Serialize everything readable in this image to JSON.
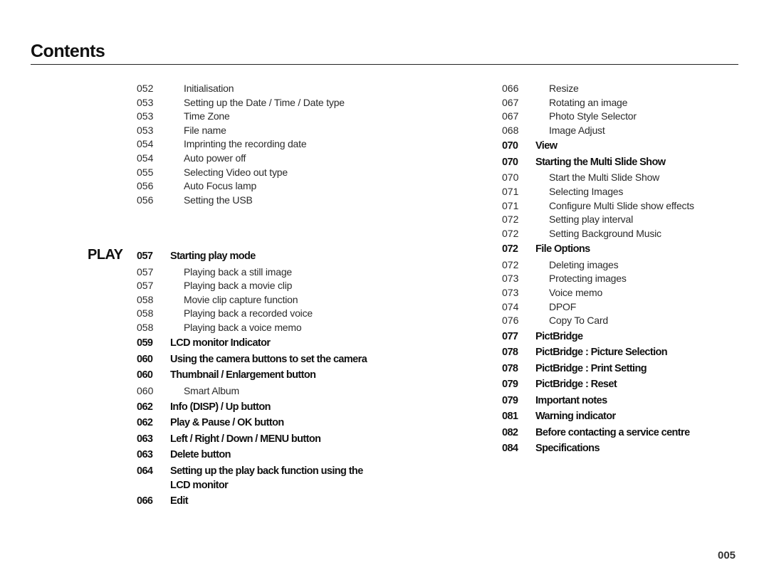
{
  "page": {
    "title": "Contents",
    "section_label": "PLAY",
    "page_number": "005"
  },
  "left_column": {
    "pre_section_entries": [
      {
        "page": "052",
        "text": "Initialisation",
        "level": "sub"
      },
      {
        "page": "053",
        "text": "Setting up the Date / Time / Date type",
        "level": "sub"
      },
      {
        "page": "053",
        "text": "Time Zone",
        "level": "sub"
      },
      {
        "page": "053",
        "text": "File name",
        "level": "sub"
      },
      {
        "page": "054",
        "text": "Imprinting the recording date",
        "level": "sub"
      },
      {
        "page": "054",
        "text": "Auto power off",
        "level": "sub"
      },
      {
        "page": "055",
        "text": "Selecting Video out type",
        "level": "sub"
      },
      {
        "page": "056",
        "text": "Auto Focus lamp",
        "level": "sub"
      },
      {
        "page": "056",
        "text": "Setting the USB",
        "level": "sub"
      }
    ],
    "play_entries": [
      {
        "page": "057",
        "text": "Starting play mode",
        "level": "head"
      },
      {
        "page": "057",
        "text": "Playing back a still image",
        "level": "sub"
      },
      {
        "page": "057",
        "text": "Playing back a movie clip",
        "level": "sub"
      },
      {
        "page": "058",
        "text": "Movie clip capture function",
        "level": "sub"
      },
      {
        "page": "058",
        "text": "Playing back a recorded voice",
        "level": "sub"
      },
      {
        "page": "058",
        "text": "Playing back a voice memo",
        "level": "sub"
      },
      {
        "page": "059",
        "text": "LCD monitor Indicator",
        "level": "head"
      },
      {
        "page": "060",
        "text": "Using the camera buttons to set the camera",
        "level": "head"
      },
      {
        "page": "060",
        "text": "Thumbnail / Enlargement button",
        "level": "head"
      },
      {
        "page": "060",
        "text": "Smart Album",
        "level": "sub"
      },
      {
        "page": "062",
        "text": "Info (DISP) / Up button",
        "level": "head"
      },
      {
        "page": "062",
        "text": "Play & Pause / OK button",
        "level": "head"
      },
      {
        "page": "063",
        "text": "Left / Right / Down / MENU button",
        "level": "head"
      },
      {
        "page": "063",
        "text": "Delete button",
        "level": "head"
      },
      {
        "page": "064",
        "text": "Setting up the play back function using the LCD monitor",
        "level": "head"
      },
      {
        "page": "066",
        "text": "Edit",
        "level": "head"
      }
    ]
  },
  "right_column": {
    "entries": [
      {
        "page": "066",
        "text": "Resize",
        "level": "sub"
      },
      {
        "page": "067",
        "text": "Rotating an image",
        "level": "sub"
      },
      {
        "page": "067",
        "text": "Photo Style Selector",
        "level": "sub"
      },
      {
        "page": "068",
        "text": "Image Adjust",
        "level": "sub"
      },
      {
        "page": "070",
        "text": "View",
        "level": "head"
      },
      {
        "page": "070",
        "text": "Starting the Multi Slide Show",
        "level": "head"
      },
      {
        "page": "070",
        "text": "Start the Multi Slide Show",
        "level": "sub"
      },
      {
        "page": "071",
        "text": "Selecting Images",
        "level": "sub"
      },
      {
        "page": "071",
        "text": "Configure Multi Slide show effects",
        "level": "sub"
      },
      {
        "page": "072",
        "text": "Setting play interval",
        "level": "sub"
      },
      {
        "page": "072",
        "text": "Setting Background Music",
        "level": "sub"
      },
      {
        "page": "072",
        "text": "File Options",
        "level": "head"
      },
      {
        "page": "072",
        "text": "Deleting images",
        "level": "sub"
      },
      {
        "page": "073",
        "text": "Protecting images",
        "level": "sub"
      },
      {
        "page": "073",
        "text": "Voice memo",
        "level": "sub"
      },
      {
        "page": "074",
        "text": "DPOF",
        "level": "sub"
      },
      {
        "page": "076",
        "text": "Copy To Card",
        "level": "sub"
      },
      {
        "page": "077",
        "text": "PictBridge",
        "level": "head"
      },
      {
        "page": "078",
        "text": "PictBridge : Picture Selection",
        "level": "head"
      },
      {
        "page": "078",
        "text": "PictBridge : Print Setting",
        "level": "head"
      },
      {
        "page": "079",
        "text": "PictBridge : Reset",
        "level": "head"
      },
      {
        "page": "079",
        "text": "Important notes",
        "level": "head"
      },
      {
        "page": "081",
        "text": "Warning indicator",
        "level": "head"
      },
      {
        "page": "082",
        "text": "Before contacting a service centre",
        "level": "head"
      },
      {
        "page": "084",
        "text": "Specifications",
        "level": "head"
      }
    ]
  }
}
